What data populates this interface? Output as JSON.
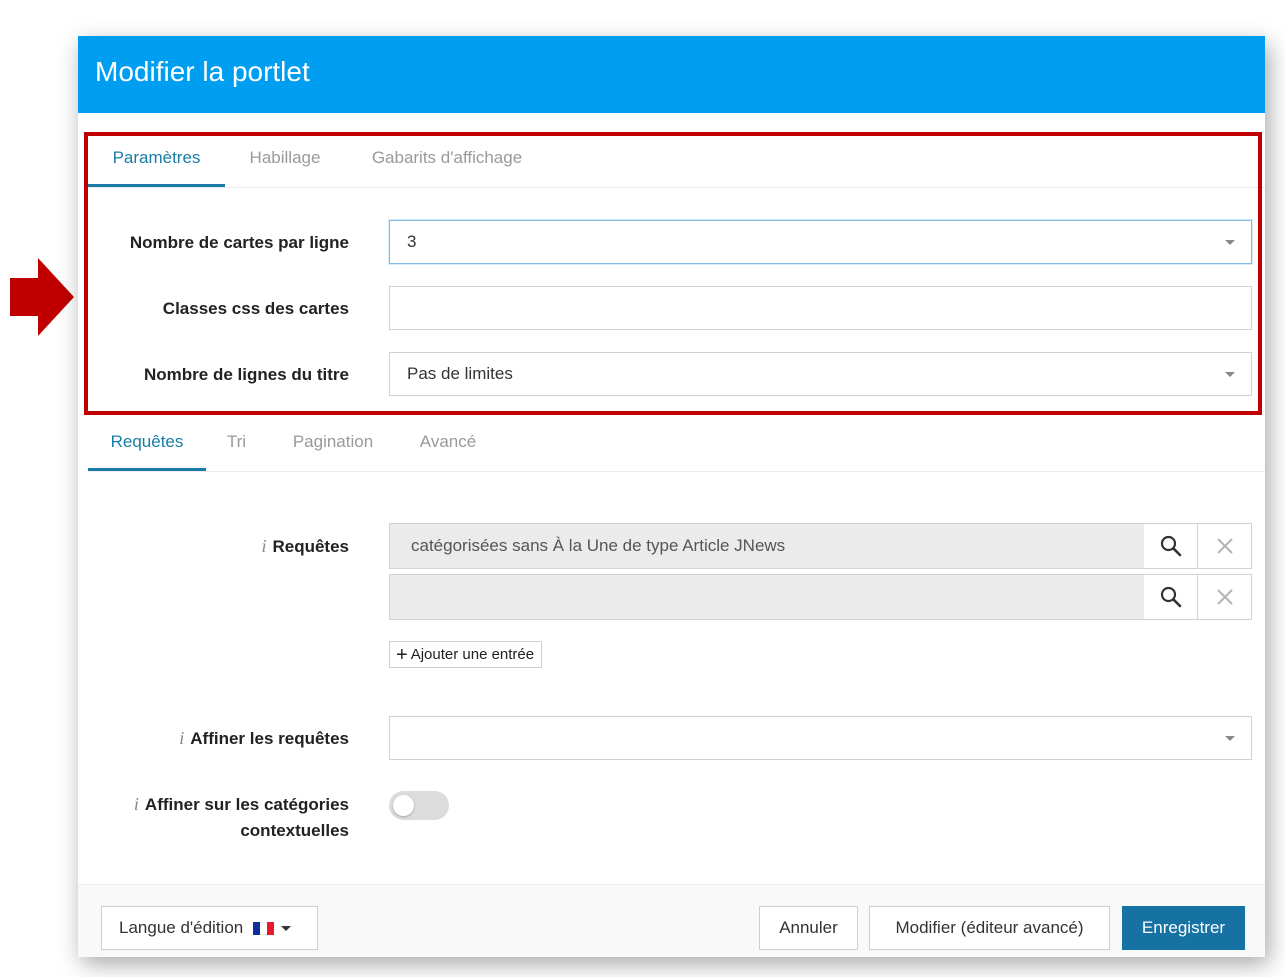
{
  "modal": {
    "title": "Modifier la portlet"
  },
  "colors": {
    "header": "#009ef1",
    "accent": "#1a7ca6",
    "primary_button": "#1672a3",
    "highlight": "#c00000",
    "flag_blue": "#0f2e9e",
    "flag_white": "#ffffff",
    "flag_red": "#e8192b"
  },
  "tabs_top": [
    {
      "label": "Paramètres",
      "active": true
    },
    {
      "label": "Habillage",
      "active": false
    },
    {
      "label": "Gabarits d'affichage",
      "active": false
    }
  ],
  "settings": {
    "cards_per_line": {
      "label": "Nombre de cartes par ligne",
      "value": "3"
    },
    "css_classes": {
      "label": "Classes css des cartes",
      "value": ""
    },
    "title_lines": {
      "label": "Nombre de lignes du titre",
      "value": "Pas de limites"
    }
  },
  "tabs_bottom": [
    {
      "label": "Requêtes",
      "active": true
    },
    {
      "label": "Tri",
      "active": false
    },
    {
      "label": "Pagination",
      "active": false
    },
    {
      "label": "Avancé",
      "active": false
    }
  ],
  "queries": {
    "info_symbol": "i",
    "label": "Requêtes",
    "entries": [
      {
        "value": "catégorisées sans À la Une de type Article JNews"
      },
      {
        "value": ""
      }
    ],
    "search_icon": "search-icon",
    "clear_icon": "close-icon",
    "add_plus": "+",
    "add_label": "Ajouter une entrée"
  },
  "refine": {
    "label": "Affiner les requêtes",
    "value": ""
  },
  "refine_contextual": {
    "label_line1": "Affiner sur les catégories",
    "label_line2": "contextuelles",
    "enabled": false
  },
  "footer": {
    "language_label": "Langue d'édition",
    "cancel_label": "Annuler",
    "advanced_label": "Modifier (éditeur avancé)",
    "save_label": "Enregistrer"
  }
}
